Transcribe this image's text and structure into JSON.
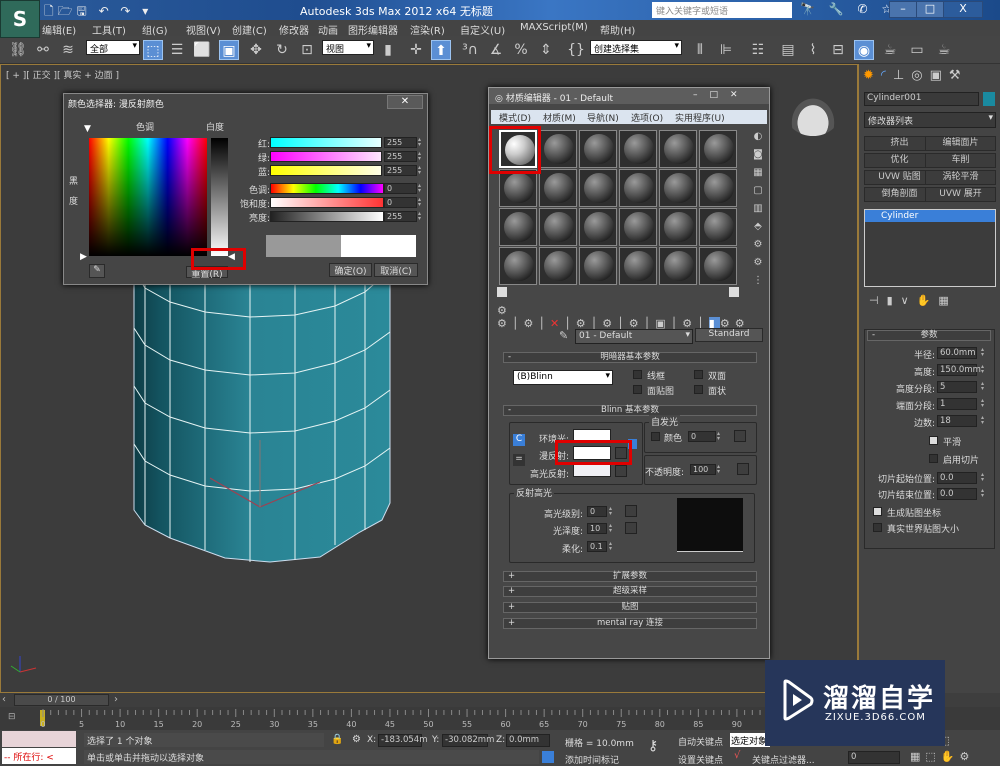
{
  "app": {
    "logo": "S",
    "title": "Autodesk 3ds Max  2012 x64      无标题",
    "search_placeholder": "键入关键字或短语",
    "win_min": "–",
    "win_max": "□",
    "win_close": "X",
    "quick_access": "🗋🗁🖫 ↶ ↷ ▾",
    "info_icons": "🔭 🔧 ✆ ☆ ?"
  },
  "menu": [
    "编辑(E)",
    "工具(T)",
    "组(G)",
    "视图(V)",
    "创建(C)",
    "修改器",
    "动画",
    "图形编辑器",
    "渲染(R)",
    "自定义(U)",
    "MAXScript(M)",
    "帮助(H)"
  ],
  "toolbar": {
    "filter": "全部",
    "coord": "视图",
    "selection_set": "创建选择集"
  },
  "viewport": {
    "label": "[ + ][ 正交 ][ 真实 + 边面 ]",
    "object_color": "#2a8494"
  },
  "color_picker": {
    "title": "颜色选择器: 漫反射颜色",
    "hue_label": "色调",
    "whiteness_label": "白度",
    "blackness_label": "黑\n度",
    "rows": [
      {
        "label": "红:",
        "value": "255"
      },
      {
        "label": "绿:",
        "value": "255"
      },
      {
        "label": "蓝:",
        "value": "255"
      },
      {
        "label": "色调:",
        "value": "0"
      },
      {
        "label": "饱和度:",
        "value": "0"
      },
      {
        "label": "亮度:",
        "value": "255"
      }
    ],
    "reset": "重置(R)",
    "ok": "确定(O)",
    "cancel": "取消(C)",
    "old_color": "#999999",
    "new_color": "#ffffff"
  },
  "material_editor": {
    "title": "材质编辑器 - 01 - Default",
    "menu": [
      "模式(D)",
      "材质(M)",
      "导航(N)",
      "选项(O)",
      "实用程序(U)"
    ],
    "material_name": "01 - Default",
    "material_type": "Standard",
    "shader_rollout": "明暗器基本参数",
    "shader": "(B)Blinn",
    "shader_opts": [
      "线框",
      "双面",
      "面贴图",
      "面状"
    ],
    "blinn_rollout": "Blinn 基本参数",
    "self_illum": "自发光",
    "self_illum_color": "颜色",
    "self_illum_value": "0",
    "ambient": "环境光:",
    "diffuse": "漫反射:",
    "specular": "高光反射:",
    "opacity_label": "不透明度:",
    "opacity": "100",
    "spec_group": "反射高光",
    "spec_level_label": "高光级别:",
    "spec_level": "0",
    "gloss_label": "光泽度:",
    "gloss": "10",
    "soften_label": "柔化:",
    "soften": "0.1",
    "rollouts": [
      "扩展参数",
      "超级采样",
      "贴图",
      "mental ray 连接"
    ]
  },
  "command_panel": {
    "object_name": "Cylinder001",
    "object_color": "#1a8aa0",
    "modifier_list": "修改器列表",
    "modifier_buttons": [
      "挤出",
      "编辑面片",
      "优化",
      "车削",
      "UVW 贴图",
      "涡轮平滑",
      "倒角剖面",
      "UVW 展开"
    ],
    "stack": [
      "Cylinder"
    ],
    "params_title": "参数",
    "params": [
      {
        "label": "半径:",
        "value": "60.0mm"
      },
      {
        "label": "高度:",
        "value": "150.0mm"
      },
      {
        "label": "高度分段:",
        "value": "5"
      },
      {
        "label": "端面分段:",
        "value": "1"
      },
      {
        "label": "边数:",
        "value": "18"
      }
    ],
    "smooth": "平滑",
    "smooth_checked": true,
    "slice_on": "启用切片",
    "slice_on_checked": false,
    "slice_from_label": "切片起始位置:",
    "slice_from": "0.0",
    "slice_to_label": "切片结束位置:",
    "slice_to": "0.0",
    "gen_map": "生成贴图坐标",
    "gen_map_checked": true,
    "real_world": "真实世界贴图大小",
    "real_world_checked": false
  },
  "timeline": {
    "position": "0 / 100",
    "ticks": [
      "0",
      "5",
      "10",
      "15",
      "20",
      "25",
      "30",
      "35",
      "40",
      "45",
      "50",
      "55",
      "60",
      "65",
      "70",
      "75",
      "80",
      "85",
      "90",
      "95",
      "100"
    ]
  },
  "status": {
    "script_label": "-- 所在行: <",
    "selected": "选择了 1 个对象",
    "prompt": "单击或单击并拖动以选择对象",
    "x_label": "X:",
    "x": "-183.054m",
    "y_label": "Y:",
    "y": "-30.082mm",
    "z_label": "Z:",
    "z": "0.0mm",
    "grid": "栅格 = 10.0mm",
    "add_tag": "添加时间标记",
    "auto_key": "自动关键点",
    "set_key": "设置关键点",
    "key_mode": "选定对象",
    "key_filter": "关键点过滤器...",
    "frame": "0"
  },
  "watermark": {
    "name": "溜溜自学",
    "url": "ZIXUE.3D66.COM"
  }
}
